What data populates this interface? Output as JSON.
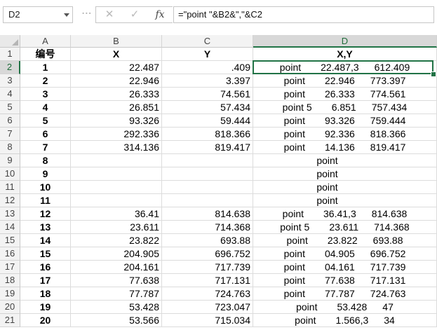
{
  "formula_bar": {
    "name_box": "D2",
    "cancel_glyph": "✕",
    "enter_glyph": "✓",
    "fx_label": "fx",
    "formula": "=\"point \"&B2&\",\"&C2"
  },
  "columns": [
    "A",
    "B",
    "C",
    "D"
  ],
  "header_row": {
    "row": "1",
    "a": "编号",
    "b": "X",
    "c": "Y",
    "d": "X,Y"
  },
  "rows": [
    {
      "row": "2",
      "a": "1",
      "b": "22.487",
      "c": ".409",
      "d": "point",
      "d_mid": "22.487,3",
      "d_end": "612.409"
    },
    {
      "row": "3",
      "a": "2",
      "b": "22.946",
      "c": "3.397",
      "d": "point",
      "d_mid": "22.946",
      "d_end": "773.397"
    },
    {
      "row": "4",
      "a": "3",
      "b": "26.333",
      "c": "74.561",
      "d": "point",
      "d_mid": "26.333",
      "d_end": "774.561"
    },
    {
      "row": "5",
      "a": "4",
      "b": "26.851",
      "c": "57.434",
      "d": "point 5",
      "d_mid": "6.851",
      "d_end": "757.434"
    },
    {
      "row": "6",
      "a": "5",
      "b": "93.326",
      "c": "59.444",
      "d": "point",
      "d_mid": "93.326",
      "d_end": "759.444"
    },
    {
      "row": "7",
      "a": "6",
      "b": "292.336",
      "c": "818.366",
      "d": "point",
      "d_mid": "92.336",
      "d_end": "818.366"
    },
    {
      "row": "8",
      "a": "7",
      "b": "314.136",
      "c": "819.417",
      "d": "point",
      "d_mid": "14.136",
      "d_end": "819.417"
    },
    {
      "row": "9",
      "a": "8",
      "b": "",
      "c": "",
      "d": "point",
      "d_mid": "",
      "d_end": ""
    },
    {
      "row": "10",
      "a": "9",
      "b": "",
      "c": "",
      "d": "point",
      "d_mid": "",
      "d_end": ""
    },
    {
      "row": "11",
      "a": "10",
      "b": "",
      "c": "",
      "d": "point",
      "d_mid": "",
      "d_end": ""
    },
    {
      "row": "12",
      "a": "11",
      "b": "",
      "c": "",
      "d": "point",
      "d_mid": "",
      "d_end": ""
    },
    {
      "row": "13",
      "a": "12",
      "b": "36.41",
      "c": "814.638",
      "d": "point",
      "d_mid": "36.41,3",
      "d_end": "814.638"
    },
    {
      "row": "14",
      "a": "13",
      "b": "23.611",
      "c": "714.368",
      "d": "point 5",
      "d_mid": "23.611",
      "d_end": "714.368"
    },
    {
      "row": "15",
      "a": "14",
      "b": "23.822",
      "c": "693.88",
      "d": "point",
      "d_mid": "23.822",
      "d_end": "693.88"
    },
    {
      "row": "16",
      "a": "15",
      "b": "204.905",
      "c": "696.752",
      "d": "point",
      "d_mid": "04.905",
      "d_end": "696.752"
    },
    {
      "row": "17",
      "a": "16",
      "b": "204.161",
      "c": "717.739",
      "d": "point",
      "d_mid": "04.161",
      "d_end": "717.739"
    },
    {
      "row": "18",
      "a": "17",
      "b": "77.638",
      "c": "717.131",
      "d": "point",
      "d_mid": "77.638",
      "d_end": "717.131"
    },
    {
      "row": "19",
      "a": "18",
      "b": "77.787",
      "c": "724.763",
      "d": "point",
      "d_mid": "77.787",
      "d_end": "724.763"
    },
    {
      "row": "20",
      "a": "19",
      "b": "53.428",
      "c": "723.047",
      "d": "point",
      "d_mid": "53.428",
      "d_end": "47"
    },
    {
      "row": "21",
      "a": "20",
      "b": "53.566",
      "c": "715.034",
      "d": "point",
      "d_mid": "1.566,3",
      "d_end": "34"
    }
  ],
  "colors": {
    "accent": "#217346",
    "header_bg": "#f3f3f3",
    "gridline": "#dcdcdc"
  }
}
